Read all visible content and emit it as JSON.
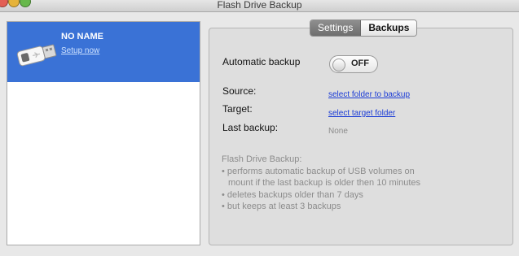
{
  "window": {
    "title": "Flash Drive Backup"
  },
  "drives": [
    {
      "name": "NO NAME",
      "action_link": "Setup now"
    }
  ],
  "tabs": [
    "Settings",
    "Backups"
  ],
  "settings": {
    "automatic_backup": {
      "label": "Automatic backup",
      "state": "OFF"
    },
    "source": {
      "label": "Source:",
      "link": "select folder to backup"
    },
    "target": {
      "label": "Target:",
      "link": "select target folder"
    },
    "last_backup": {
      "label": "Last backup:",
      "value": "None"
    }
  },
  "description": {
    "heading": "Flash Drive Backup:",
    "items": [
      "• performs automatic backup of USB volumes on",
      "  mount if the last backup is older then 10 minutes",
      "• deletes backups older than 7 days",
      "• but keeps at least 3 backups"
    ]
  },
  "colors": {
    "selection": "#3a72d6",
    "link": "#1a3bd6",
    "window_bg": "#e8e8e8",
    "panel_bg": "#dedede"
  },
  "icons": {
    "drive": "usb-drive-icon",
    "close": "close-button",
    "minimize": "minimize-button",
    "zoom": "zoom-button"
  }
}
